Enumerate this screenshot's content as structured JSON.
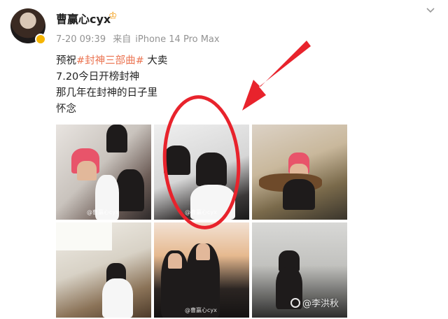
{
  "post": {
    "author": "曹赢心cyx",
    "time": "7-20 09:39",
    "source_prefix": "来自",
    "device": "iPhone 14 Pro Max",
    "text_prefix": "预祝",
    "hashtag": "#封神三部曲#",
    "text_suffix": " 大卖",
    "line2": "7.20今日开榜封神",
    "line3": "那几年在封神的日子里",
    "line4": "怀念"
  },
  "photos": {
    "watermark": "@曹赢心cyx",
    "items": [
      "photo-1",
      "photo-2",
      "photo-3",
      "photo-4",
      "photo-5",
      "photo-6"
    ]
  },
  "overlay": {
    "site_watermark": "@李洪秋",
    "highlight_color": "#e8232c"
  },
  "icons": {
    "more": "chevron-down-icon",
    "verified": "verified-badge-icon",
    "crown": "crown-icon"
  }
}
